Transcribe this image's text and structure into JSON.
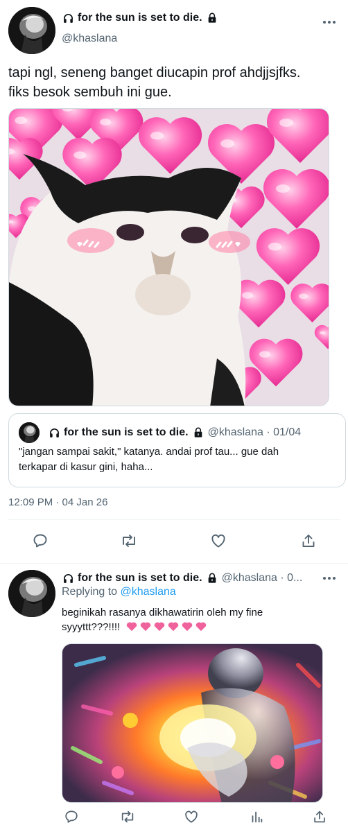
{
  "main_tweet": {
    "display_name": "for the sun is set to die.",
    "handle": "@khaslana",
    "text_line1": "tapi ngl, seneng banget diucapin prof ahdjjsjfks.",
    "text_line2": "fiks besok sembuh ini gue.",
    "image_alt": "crying cat surrounded by pink hearts",
    "timestamp": "12:09 PM · 04 Jan 26"
  },
  "quoted_tweet": {
    "display_name": "for the sun is set to die.",
    "handle_date": "@khaslana · 01/04",
    "text_line1": "\"jangan sampai sakit,\" katanya. andai prof tau... gue dah",
    "text_line2": "terkapar di kasur gini, haha..."
  },
  "reply_tweet": {
    "display_name": "for the sun is set to die.",
    "handle_date": "@khaslana · 0...",
    "replying_to_prefix": "Replying to ",
    "replying_to_handle": "@khaslana",
    "text_line1": "beginikah rasanya dikhawatirin oleh my fine",
    "text_line2": "syyyttt???!!!!",
    "image_alt": "glowing figure holding a bright light"
  },
  "colors": {
    "text": "#0f1419",
    "secondary": "#536471",
    "link": "#1d9bf0",
    "border": "#cfd9de",
    "heart_emoji": "#f0629b"
  },
  "icons": [
    "headphones-icon",
    "lock-icon",
    "more-icon",
    "reply-icon",
    "retweet-icon",
    "like-icon",
    "share-icon",
    "analytics-icon"
  ]
}
